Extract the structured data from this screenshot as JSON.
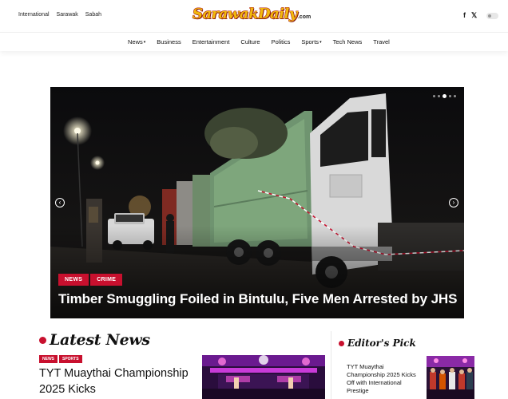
{
  "topbar": {
    "links": [
      "International",
      "Sarawak",
      "Sabah"
    ],
    "logo_main": "SarawakDaily",
    "logo_suffix": ".com",
    "social": {
      "facebook": "f",
      "x": "𝕏"
    }
  },
  "nav": {
    "items": [
      {
        "label": "News",
        "dropdown": true
      },
      {
        "label": "Business",
        "dropdown": false
      },
      {
        "label": "Entertainment",
        "dropdown": false
      },
      {
        "label": "Culture",
        "dropdown": false
      },
      {
        "label": "Politics",
        "dropdown": false
      },
      {
        "label": "Sports",
        "dropdown": true
      },
      {
        "label": "Tech News",
        "dropdown": false
      },
      {
        "label": "Travel",
        "dropdown": false
      }
    ]
  },
  "hero": {
    "tags": [
      "NEWS",
      "CRIME"
    ],
    "title": "Timber Smuggling Foiled in Bintulu, Five Men Arrested by JHS",
    "slides_total": 5,
    "active_slide": 3
  },
  "latest": {
    "heading": "Latest News",
    "tags": [
      "NEWS",
      "SPORTS"
    ],
    "article_title": "TYT Muaythai Championship 2025 Kicks"
  },
  "editors_pick": {
    "heading": "Editor's Pick",
    "article_title": "TYT Muaythai Championship 2025 Kicks Off with International Prestige"
  },
  "colors": {
    "accent_red": "#c8102e",
    "logo_yellow": "#f2b90d"
  }
}
